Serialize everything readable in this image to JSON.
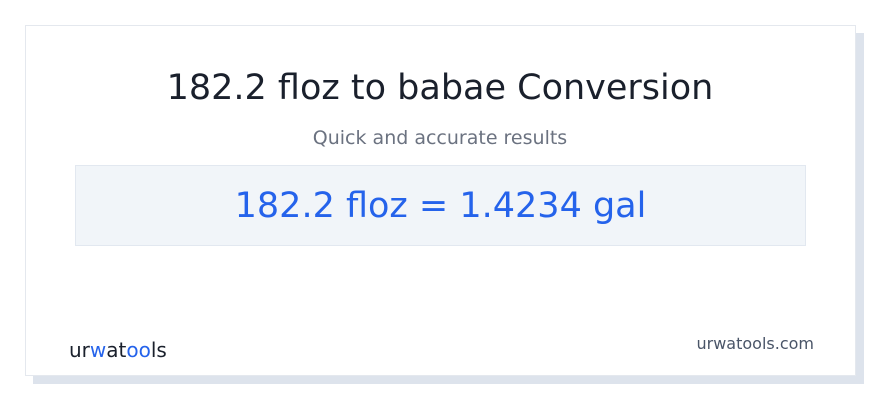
{
  "card": {
    "title": "182.2 floz to babae Conversion",
    "subtitle": "Quick and accurate results",
    "result": "182.2 floz = 1.4234 gal"
  },
  "footer": {
    "logo_text": "urwatools",
    "site": "urwatools.com"
  },
  "colors": {
    "title": "#1a202c",
    "accent": "#2563eb",
    "muted": "#6b7280",
    "result_bg": "#f1f5f9"
  }
}
